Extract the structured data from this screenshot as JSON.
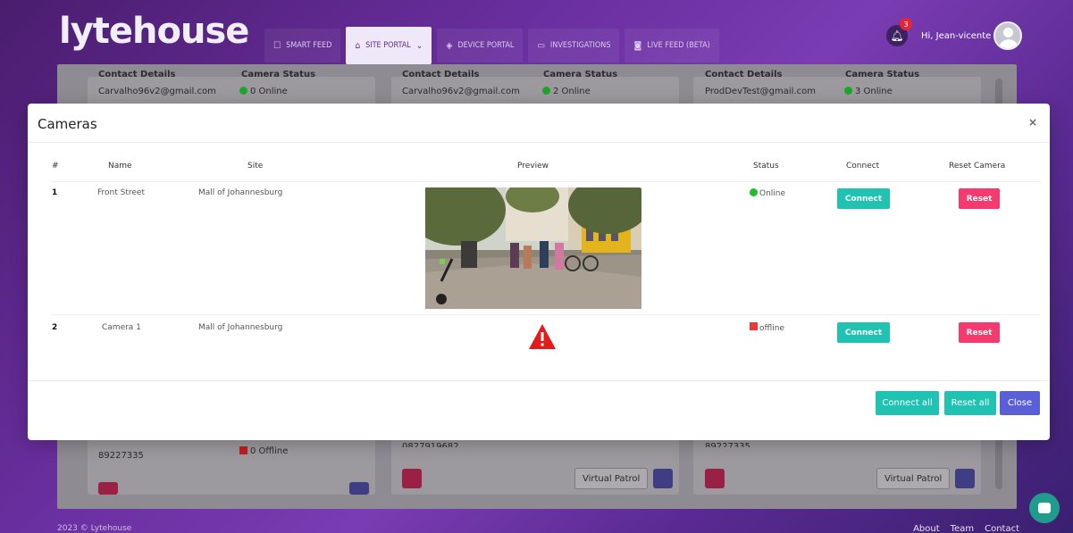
{
  "brand": {
    "logo": "lytehouse"
  },
  "nav": {
    "tabs": [
      {
        "label": "SMART FEED",
        "icon": "bulb-icon"
      },
      {
        "label": "SITE PORTAL",
        "icon": "home-icon",
        "active": true
      },
      {
        "label": "DEVICE PORTAL",
        "icon": "shield-icon"
      },
      {
        "label": "INVESTIGATIONS",
        "icon": "folder-icon"
      },
      {
        "label": "LIVE FEED (BETA)",
        "icon": "camera-icon"
      }
    ]
  },
  "user": {
    "greeting": "Hi, Jean-vicente",
    "notifications": "3"
  },
  "background": {
    "cards": [
      {
        "contact_head": "Contact Details",
        "email": "Carvalho96v2@gmail.com",
        "status_head": "Camera Status",
        "online": "0 Online",
        "offline": "0 Offline",
        "phone": "89227335"
      },
      {
        "contact_head": "Contact Details",
        "email": "Carvalho96v2@gmail.com",
        "status_head": "Camera Status",
        "online": "2 Online",
        "phone": "0827919682",
        "patrol": "Virtual Patrol"
      },
      {
        "contact_head": "Contact Details",
        "email": "ProdDevTest@gmail.com",
        "status_head": "Camera Status",
        "online": "3 Online",
        "phone": "89227335",
        "patrol": "Virtual Patrol"
      }
    ]
  },
  "modal": {
    "title": "Cameras",
    "close_symbol": "×",
    "headers": {
      "num": "#",
      "name": "Name",
      "site": "Site",
      "preview": "Preview",
      "status": "Status",
      "connect": "Connect",
      "reset": "Reset Camera"
    },
    "rows": [
      {
        "num": "1",
        "name": "Front Street",
        "site": "Mall of Johannesburg",
        "status": "Online",
        "status_color": "#1fbf2a",
        "connect": "Connect",
        "reset": "Reset"
      },
      {
        "num": "2",
        "name": "Camera 1",
        "site": "Mall of Johannesburg",
        "status": "offline",
        "status_color": "#e83a3a",
        "connect": "Connect",
        "reset": "Reset"
      }
    ],
    "footer": {
      "connect_all": "Connect all",
      "reset_all": "Reset all",
      "close": "Close"
    }
  },
  "footer": {
    "copyright": "2023 © Lytehouse",
    "links": [
      "About",
      "Team",
      "Contact"
    ]
  },
  "colors": {
    "accent_teal": "#20c2b1",
    "reset_pink": "#f53a6f",
    "close_purple": "#5a5fd8"
  }
}
